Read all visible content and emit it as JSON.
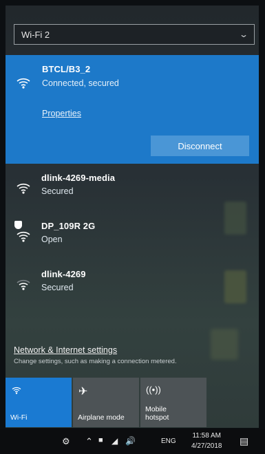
{
  "adapter_select": {
    "value": "Wi-Fi 2"
  },
  "connected_network": {
    "name": "BTCL/B3_2",
    "status": "Connected, secured",
    "properties_label": "Properties",
    "disconnect_label": "Disconnect"
  },
  "networks": [
    {
      "name": "dlink-4269-media",
      "status": "Secured"
    },
    {
      "name": "DP_109R 2G",
      "status": "Open"
    },
    {
      "name": "dlink-4269",
      "status": "Secured"
    }
  ],
  "settings": {
    "link": "Network & Internet settings",
    "subtitle": "Change settings, such as making a connection metered."
  },
  "quick_actions": [
    {
      "label": "Wi-Fi",
      "icon": "wifi-icon",
      "active": true
    },
    {
      "label": "Airplane mode",
      "icon": "airplane-icon",
      "active": false
    },
    {
      "label": "Mobile hotspot",
      "icon": "hotspot-icon",
      "active": false
    }
  ],
  "taskbar": {
    "language": "ENG",
    "time": "11:58 AM",
    "date": "4/27/2018"
  },
  "colors": {
    "accent": "#1d79c9",
    "tile_active": "#1a7ad2",
    "tile_inactive": "#4d5356"
  }
}
